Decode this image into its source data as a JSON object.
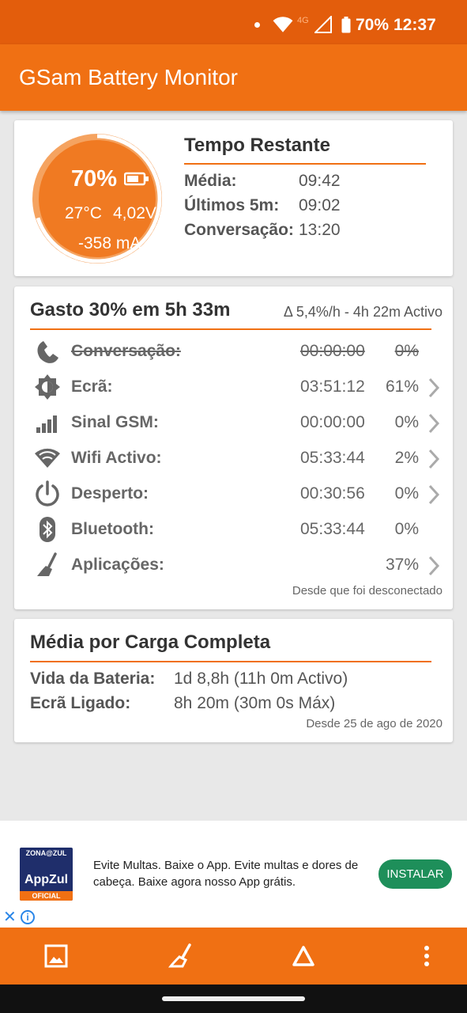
{
  "status_bar": {
    "network": "4G",
    "battery": "70%",
    "time": "12:37",
    "icons": [
      "notification-dot-icon",
      "wifi-icon",
      "signal-icon",
      "battery-icon"
    ]
  },
  "app_bar": {
    "title": "GSam Battery Monitor"
  },
  "gauge": {
    "percent": "70%",
    "level": 0.7,
    "temperature": "27°C",
    "voltage": "4,02V",
    "current": "-358 mA"
  },
  "remaining": {
    "title": "Tempo Restante",
    "rows": [
      {
        "label": "Média:",
        "value": "09:42"
      },
      {
        "label": "Últimos 5m:",
        "value": "09:02"
      },
      {
        "label": "Conversação:",
        "value": "13:20"
      }
    ]
  },
  "usage": {
    "title": "Gasto 30% em 5h 33m",
    "subtitle": "Δ 5,4%/h - 4h 22m Activo",
    "rows": [
      {
        "icon": "phone-icon",
        "label": "Conversação:",
        "time": "00:00:00",
        "percent": "0%",
        "struck": true,
        "chevron": false
      },
      {
        "icon": "screen-brightness-icon",
        "label": "Ecrã:",
        "time": "03:51:12",
        "percent": "61%",
        "struck": false,
        "chevron": true
      },
      {
        "icon": "cell-signal-icon",
        "label": "Sinal GSM:",
        "time": "00:00:00",
        "percent": "0%",
        "struck": false,
        "chevron": true
      },
      {
        "icon": "wifi-icon",
        "label": "Wifi Activo:",
        "time": "05:33:44",
        "percent": "2%",
        "struck": false,
        "chevron": true
      },
      {
        "icon": "power-icon",
        "label": "Desperto:",
        "time": "00:30:56",
        "percent": "0%",
        "struck": false,
        "chevron": true
      },
      {
        "icon": "bluetooth-icon",
        "label": "Bluetooth:",
        "time": "05:33:44",
        "percent": "0%",
        "struck": false,
        "chevron": false
      },
      {
        "icon": "broom-icon",
        "label": "Aplicações:",
        "time": "",
        "percent": "37%",
        "struck": false,
        "chevron": true
      }
    ],
    "footer": "Desde que foi desconectado"
  },
  "average": {
    "title": "Média por Carga Completa",
    "rows": [
      {
        "label": "Vida da Bateria:",
        "value": "1d 8,8h (11h 0m Activo)"
      },
      {
        "label": "Ecrã Ligado:",
        "value": "8h 20m (30m 0s Máx)"
      }
    ],
    "footer": "Desde 25 de ago de 2020"
  },
  "ad": {
    "logo_top": "ZONA@ZUL",
    "logo_name": "AppZul",
    "logo_badge": "OFICIAL",
    "text": "Evite Multas. Baixe o App. Evite multas e dores de cabeça. Baixe agora nosso App grátis.",
    "button": "INSTALAR",
    "close_symbol": "✕",
    "info_symbol": "i"
  },
  "bottom_bar": {
    "buttons": [
      "image-icon",
      "broom-icon",
      "delta-icon",
      "more-vert-icon"
    ]
  },
  "colors": {
    "primary": "#f07013",
    "status_bar": "#e35d0c",
    "gauge": "#f07a22",
    "install_button": "#1e8f5a"
  }
}
